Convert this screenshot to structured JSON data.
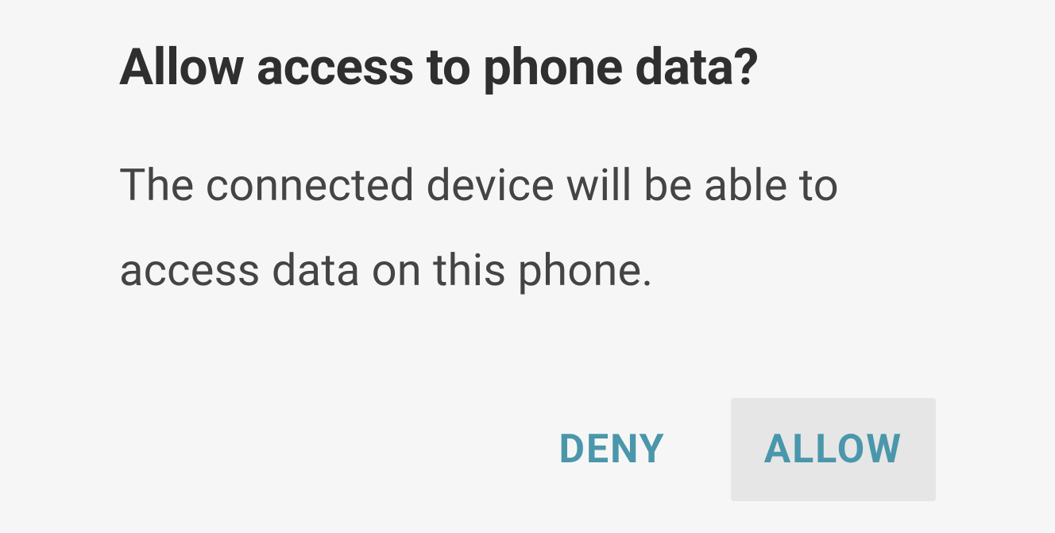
{
  "dialog": {
    "title": "Allow access to phone data?",
    "body": "The connected device will be able to access data on this phone.",
    "actions": {
      "deny": "DENY",
      "allow": "ALLOW"
    }
  }
}
